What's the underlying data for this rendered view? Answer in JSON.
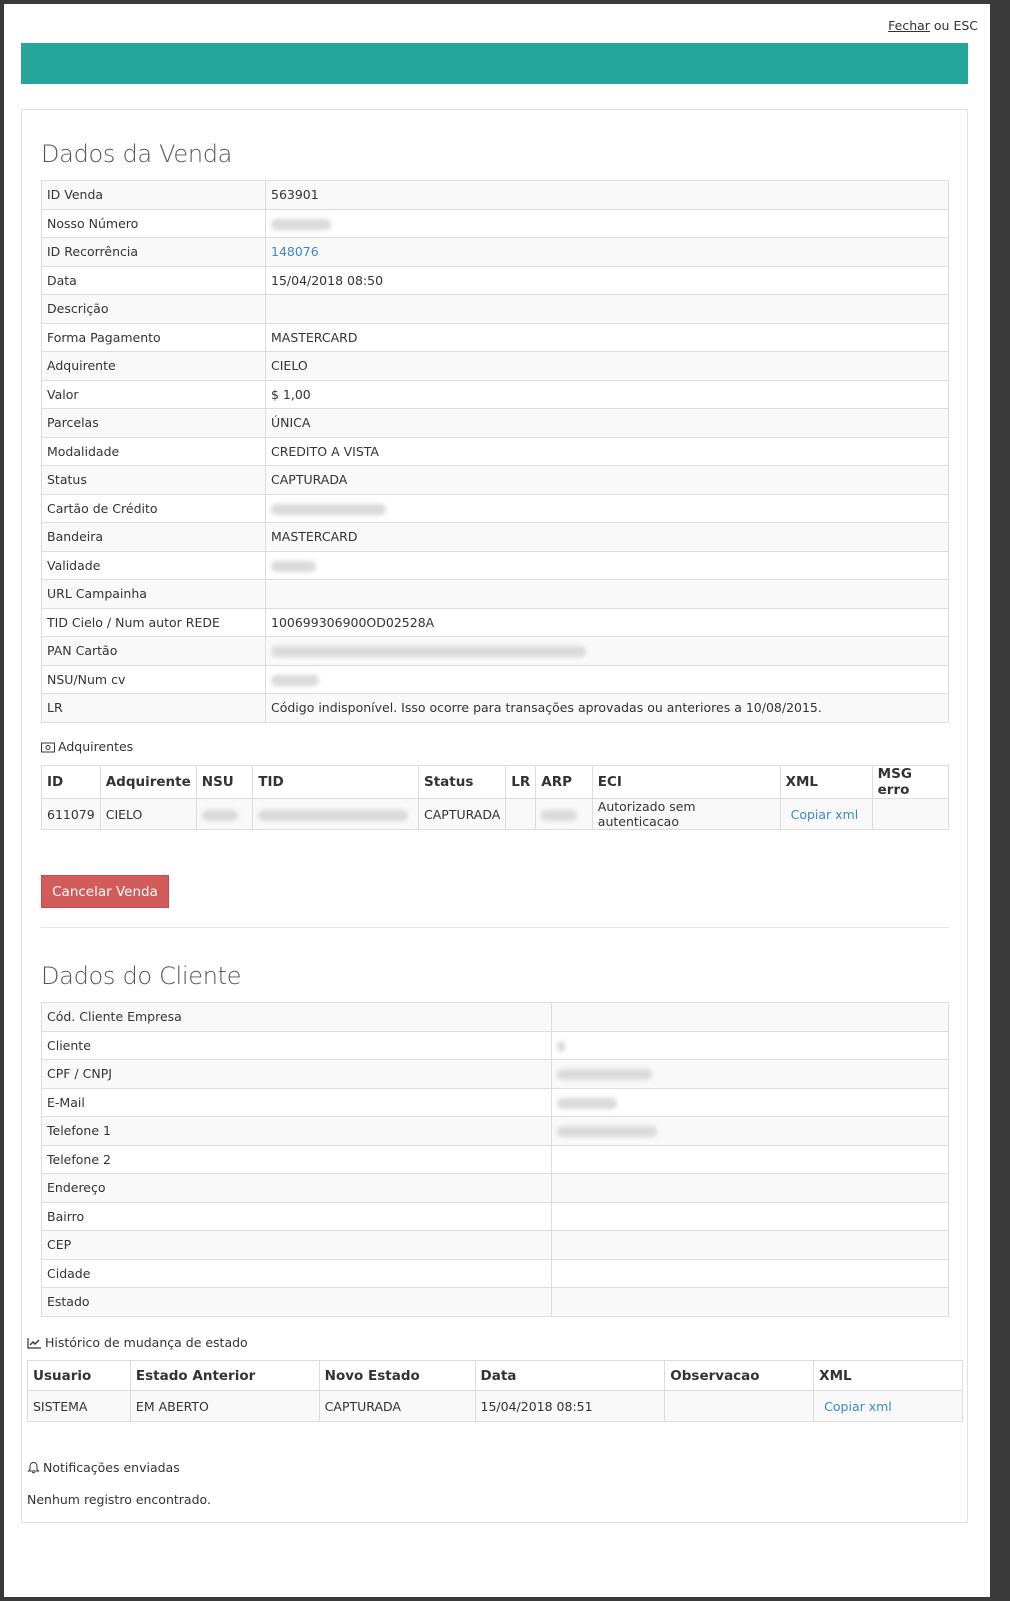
{
  "topbar": {
    "close_label": "Fechar",
    "esc_label": " ou ESC"
  },
  "venda": {
    "title": "Dados da Venda",
    "rows": [
      {
        "key": "ID Venda",
        "value": "563901"
      },
      {
        "key": "Nosso Número",
        "value": ""
      },
      {
        "key": "ID Recorrência",
        "value": "148076"
      },
      {
        "key": "Data",
        "value": "15/04/2018 08:50"
      },
      {
        "key": "Descrição",
        "value": ""
      },
      {
        "key": "Forma Pagamento",
        "value": "MASTERCARD"
      },
      {
        "key": "Adquirente",
        "value": "CIELO"
      },
      {
        "key": "Valor",
        "value": "$ 1,00"
      },
      {
        "key": "Parcelas",
        "value": "ÚNICA"
      },
      {
        "key": "Modalidade",
        "value": "CREDITO A VISTA"
      },
      {
        "key": "Status",
        "value": "CAPTURADA"
      },
      {
        "key": "Cartão de Crédito",
        "value": ""
      },
      {
        "key": "Bandeira",
        "value": "MASTERCARD"
      },
      {
        "key": "Validade",
        "value": ""
      },
      {
        "key": "URL Campainha",
        "value": ""
      },
      {
        "key": "TID Cielo / Num autor REDE",
        "value": "100699306900OD02528A"
      },
      {
        "key": "PAN Cartão",
        "value": ""
      },
      {
        "key": "NSU/Num cv",
        "value": ""
      },
      {
        "key": "LR",
        "value": "Código indisponível. Isso ocorre para transações aprovadas ou anteriores a 10/08/2015."
      }
    ]
  },
  "adquirentes": {
    "heading": "Adquirentes",
    "columns": [
      "ID",
      "Adquirente",
      "NSU",
      "TID",
      "Status",
      "LR",
      "ARP",
      "ECI",
      "XML",
      "MSG erro"
    ],
    "row": {
      "id": "611079",
      "adquirente": "CIELO",
      "status": "CAPTURADA",
      "eci": "Autorizado sem autenticacao",
      "xml": "Copiar xml"
    }
  },
  "actions": {
    "cancel_label": "Cancelar Venda"
  },
  "cliente": {
    "title": "Dados do Cliente",
    "rows": [
      {
        "key": "Cód. Cliente Empresa"
      },
      {
        "key": "Cliente"
      },
      {
        "key": "CPF / CNPJ"
      },
      {
        "key": "E-Mail"
      },
      {
        "key": "Telefone 1"
      },
      {
        "key": "Telefone 2"
      },
      {
        "key": "Endereço"
      },
      {
        "key": "Bairro"
      },
      {
        "key": "CEP"
      },
      {
        "key": "Cidade"
      },
      {
        "key": "Estado"
      }
    ]
  },
  "historico": {
    "heading": "Histórico de mudança de estado",
    "columns": [
      "Usuario",
      "Estado Anterior",
      "Novo Estado",
      "Data",
      "Observacao",
      "XML"
    ],
    "row": {
      "usuario": "SISTEMA",
      "anterior": "EM ABERTO",
      "novo": "CAPTURADA",
      "data": "15/04/2018 08:51",
      "obs": "",
      "xml": "Copiar xml"
    }
  },
  "notificacoes": {
    "heading": "Notificações enviadas",
    "empty": "Nenhum registro encontrado."
  }
}
